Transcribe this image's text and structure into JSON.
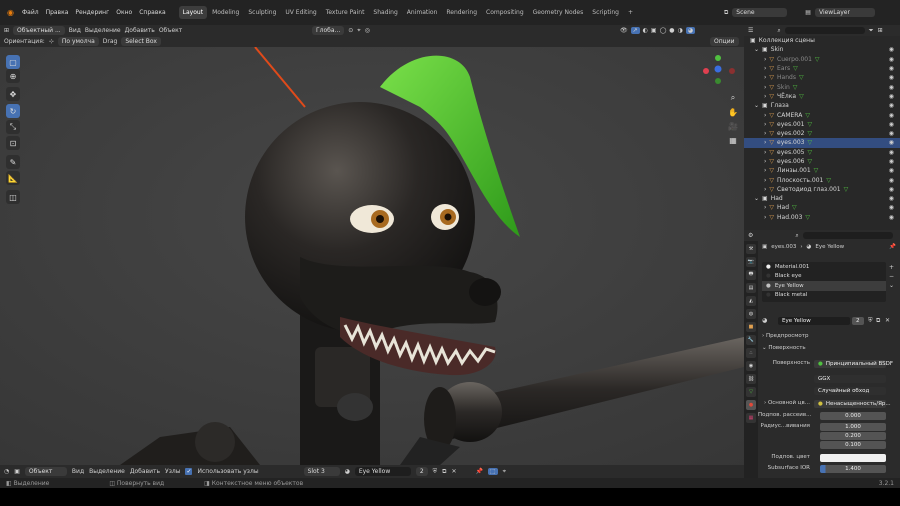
{
  "menu": {
    "items": [
      "Файл",
      "Правка",
      "Рендеринг",
      "Окно",
      "Справка"
    ],
    "workspaces": [
      "Layout",
      "Modeling",
      "Sculpting",
      "UV Editing",
      "Texture Paint",
      "Shading",
      "Animation",
      "Rendering",
      "Compositing",
      "Geometry Nodes",
      "Scripting"
    ],
    "active_workspace": "Layout",
    "add_tab": "+",
    "scene": "Scene",
    "view_layer": "ViewLayer"
  },
  "viewport_header": {
    "mode": "Объектный ...",
    "menus": [
      "Вид",
      "Выделение",
      "Добавить",
      "Объект"
    ],
    "transform": "Глоба...",
    "orientation_label": "Ориентация:",
    "orientation_value": "По умолча",
    "drag_label": "Drag",
    "drag_value": "Select Box",
    "options": "Опции"
  },
  "tools": [
    "select",
    "cursor",
    "move",
    "rotate",
    "scale",
    "transform",
    "annotate",
    "measure",
    "add-cube"
  ],
  "outliner": {
    "search_placeholder": "",
    "root": "Коллекция сцены",
    "rows": [
      {
        "label": "Skin",
        "type": "collection",
        "indent": 1
      },
      {
        "label": "Cuerpo.001",
        "type": "object",
        "indent": 2,
        "dim": true
      },
      {
        "label": "Ears",
        "type": "object",
        "indent": 2,
        "dim": true
      },
      {
        "label": "Hands",
        "type": "object",
        "indent": 2,
        "dim": true
      },
      {
        "label": "Skin",
        "type": "object",
        "indent": 2,
        "dim": true
      },
      {
        "label": "ЧЁлка",
        "type": "object",
        "indent": 2,
        "dim": false
      },
      {
        "label": "Глаза",
        "type": "collection",
        "indent": 1
      },
      {
        "label": "CAMERA",
        "type": "object",
        "indent": 2
      },
      {
        "label": "eyes.001",
        "type": "object",
        "indent": 2
      },
      {
        "label": "eyes.002",
        "type": "object",
        "indent": 2
      },
      {
        "label": "eyes.003",
        "type": "object",
        "indent": 2,
        "selected": true
      },
      {
        "label": "eyes.005",
        "type": "object",
        "indent": 2
      },
      {
        "label": "eyes.006",
        "type": "object",
        "indent": 2
      },
      {
        "label": "Линзы.001",
        "type": "object",
        "indent": 2
      },
      {
        "label": "Плоскость.001",
        "type": "object",
        "indent": 2
      },
      {
        "label": "Светодиод глаз.001",
        "type": "object",
        "indent": 2
      },
      {
        "label": "Had",
        "type": "collection",
        "indent": 1
      },
      {
        "label": "Had",
        "type": "object",
        "indent": 2
      },
      {
        "label": "Had.003",
        "type": "object",
        "indent": 2
      }
    ]
  },
  "properties": {
    "breadcrumb_object": "eyes.003",
    "breadcrumb_material": "Eye Yellow",
    "slots": [
      "Material.001",
      "Black eye",
      "Eye Yellow",
      "Black metal"
    ],
    "active_slot": "Eye Yellow",
    "material_name": "Eye Yellow",
    "user_count": "2",
    "panel_preview": "Предпросмотр",
    "panel_surface": "Поверхность",
    "surface_label": "Поверхность",
    "surface_value": "Принципиальный BSDF",
    "distribution": "GGX",
    "subsurface_method": "Случайный обход",
    "base_color_label": "Основной цв...",
    "base_color_value": "Ненасыщенность/Яр...",
    "subsurface_label": "Подпов. рассеив...",
    "subsurface_value": "0.000",
    "radius_label": "Радиус...вивания",
    "radius_values": [
      "1.000",
      "0.200",
      "0.100"
    ],
    "subsurface_color_label": "Подпов. цвет",
    "ior_label": "Subsurface IOR",
    "ior_value": "1.400"
  },
  "timeline": {
    "mode": "Объект",
    "menus": [
      "Вид",
      "Выделение",
      "Добавить",
      "Узлы"
    ],
    "use_nodes_label": "Использовать узлы",
    "slot": "Slot 3",
    "material": "Eye Yellow",
    "users": "2"
  },
  "status": {
    "items": [
      "Выделение",
      "Повернуть вид",
      "Контекстное меню объектов"
    ],
    "version": "3.2.1"
  },
  "colors": {
    "accent": "#4772b3",
    "orange": "#e0a050",
    "green": "#4fc94f"
  }
}
